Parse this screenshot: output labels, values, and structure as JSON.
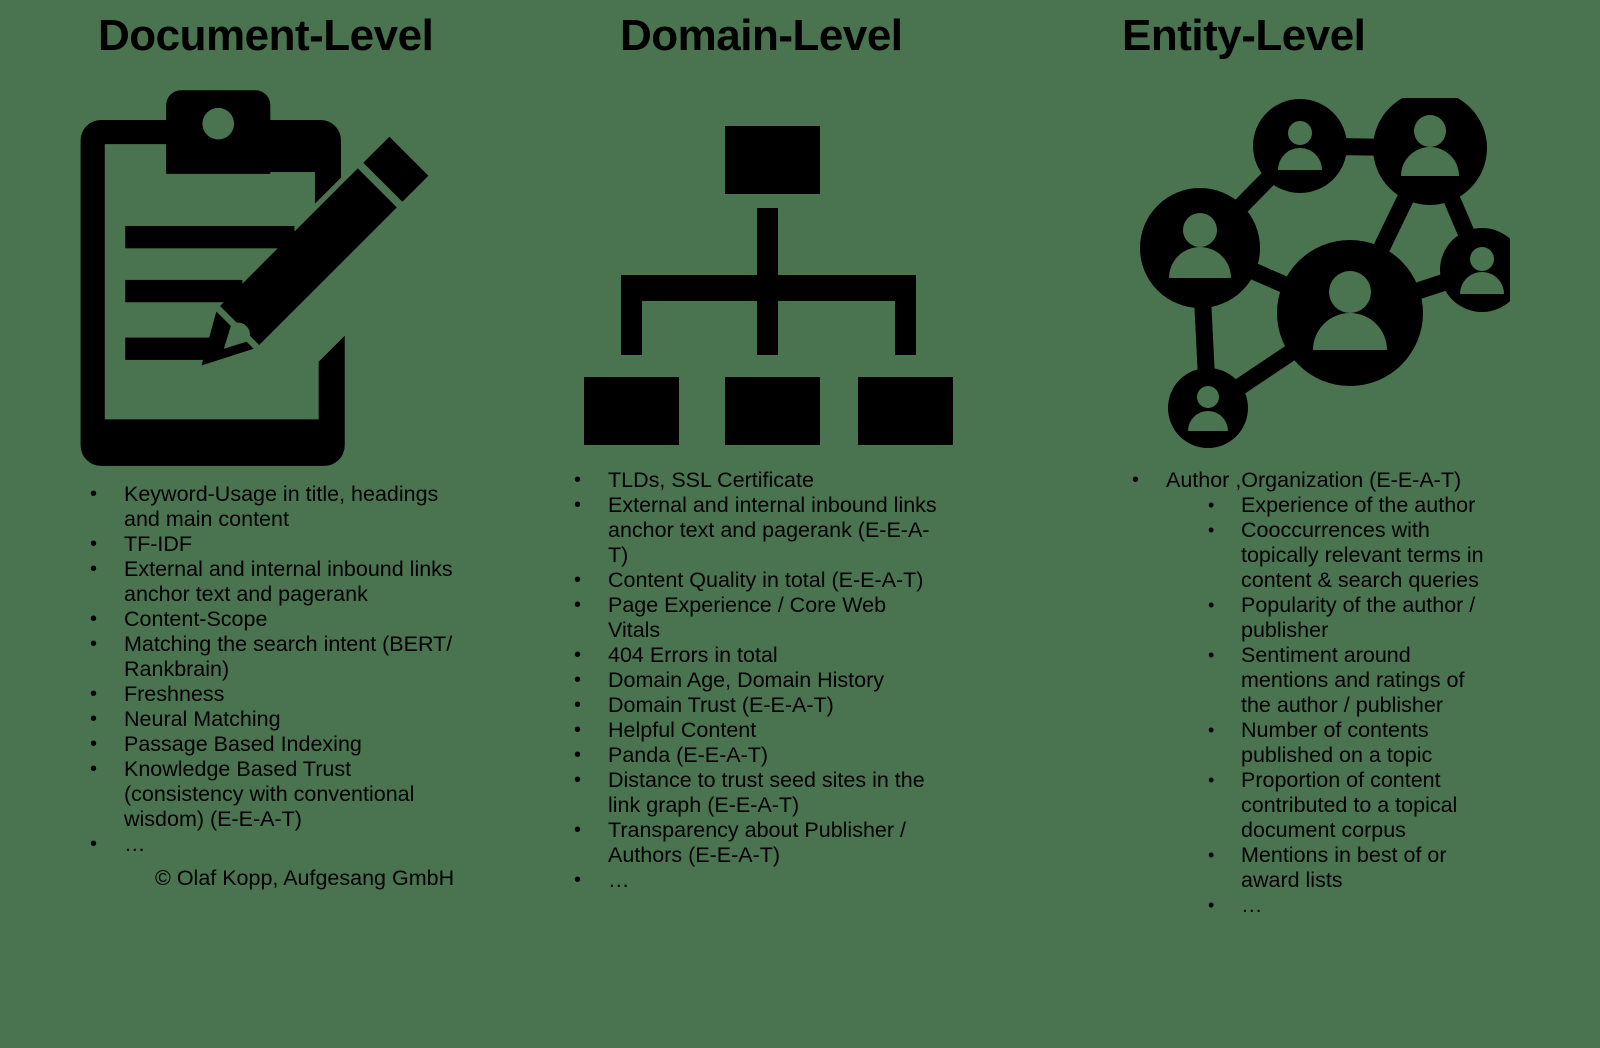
{
  "background_color": "#4a7350",
  "foreground_color": "#000000",
  "columns": [
    {
      "title": "Document-Level",
      "icon": "clipboard-pencil-icon",
      "items": [
        {
          "text": "Keyword-Usage in title, headings and main content"
        },
        {
          "text": "TF-IDF"
        },
        {
          "text": "External and internal inbound links anchor text and pagerank"
        },
        {
          "text": "Content-Scope"
        },
        {
          "text": "Matching the search intent (BERT/ Rankbrain)"
        },
        {
          "text": "Freshness"
        },
        {
          "text": "Neural Matching"
        },
        {
          "text": "Passage Based Indexing"
        },
        {
          "text": "Knowledge Based Trust (consistency with conventional wisdom) (E-E-A-T)"
        },
        {
          "text": "…"
        }
      ],
      "credit": "© Olaf Kopp, Aufgesang GmbH"
    },
    {
      "title": "Domain-Level",
      "icon": "sitemap-hierarchy-icon",
      "items": [
        {
          "text": "TLDs, SSL Certificate"
        },
        {
          "text": "External and internal inbound links anchor text and pagerank (E-E-A-T)"
        },
        {
          "text": "Content Quality in total (E-E-A-T)"
        },
        {
          "text": "Page Experience / Core Web Vitals"
        },
        {
          "text": "404 Errors in total"
        },
        {
          "text": "Domain Age, Domain History"
        },
        {
          "text": "Domain Trust (E-E-A-T)"
        },
        {
          "text": "Helpful Content"
        },
        {
          "text": "Panda (E-E-A-T)"
        },
        {
          "text": "Distance to trust seed sites in the link graph (E-E-A-T)"
        },
        {
          "text": "Transparency about Publisher / Authors (E-E-A-T)"
        },
        {
          "text": "…"
        }
      ]
    },
    {
      "title": "Entity-Level",
      "icon": "entity-network-icon",
      "items": [
        {
          "text": "Author ,Organization (E-E-A-T)",
          "subitems": [
            {
              "text": "Experience of the author"
            },
            {
              "text": "Cooccurrences with topically relevant terms in content & search queries"
            },
            {
              "text": "Popularity of the author / publisher"
            },
            {
              "text": "Sentiment around mentions and ratings of the author / publisher"
            },
            {
              "text": "Number of contents published on a topic"
            },
            {
              "text": "Proportion of content contributed to a topical document corpus"
            },
            {
              "text": "Mentions in best of or award lists"
            },
            {
              "text": "…"
            }
          ]
        }
      ]
    }
  ]
}
